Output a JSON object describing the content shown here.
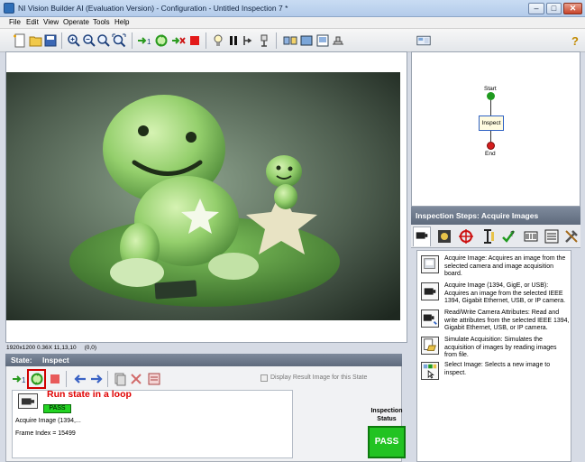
{
  "window": {
    "title": "NI Vision Builder AI (Evaluation Version) - Configuration - Untitled Inspection 7 *"
  },
  "menu": [
    "File",
    "Edit",
    "View",
    "Operate",
    "Tools",
    "Help"
  ],
  "image_status": {
    "text": "1920x1200 0.36X 11,13,10     (0,0)"
  },
  "state": {
    "label": "State:",
    "name": "Inspect",
    "display_result_label": "Display Result Image for this State",
    "annotation": "Run state in a loop",
    "result_badge": "PASS",
    "step_name": "Acquire Image (1394,...",
    "frame_index": "Frame Index = 15499",
    "inspection_status_label": "Inspection Status",
    "inspection_status_value": "PASS"
  },
  "flowchart": {
    "start": "Start",
    "inspect": "Inspect",
    "end": "End"
  },
  "steps_panel": {
    "title": "Inspection Steps: Acquire Images",
    "items": [
      {
        "icon": "camera-acquire-icon",
        "text": "Acquire Image:  Acquires an image from the selected camera and image acquisition board."
      },
      {
        "icon": "camera-1394-icon",
        "text": "Acquire Image (1394, GigE, or USB):  Acquires an image from the selected IEEE 1394, Gigabit Ethernet, USB, or IP camera."
      },
      {
        "icon": "camera-attributes-icon",
        "text": "Read/Write Camera Attributes:  Read and write attributes from the selected IEEE 1394, Gigabit Ethernet, USB, or IP camera."
      },
      {
        "icon": "simulate-acquisition-icon",
        "text": "Simulate Acquisition:  Simulates the acquisition of images by reading images from file."
      },
      {
        "icon": "select-image-icon",
        "text": "Select Image:  Selects a new image to inspect."
      }
    ]
  },
  "colors": {
    "highlight": "#d00000",
    "pass": "#22c322",
    "annotation": "#e00000"
  }
}
